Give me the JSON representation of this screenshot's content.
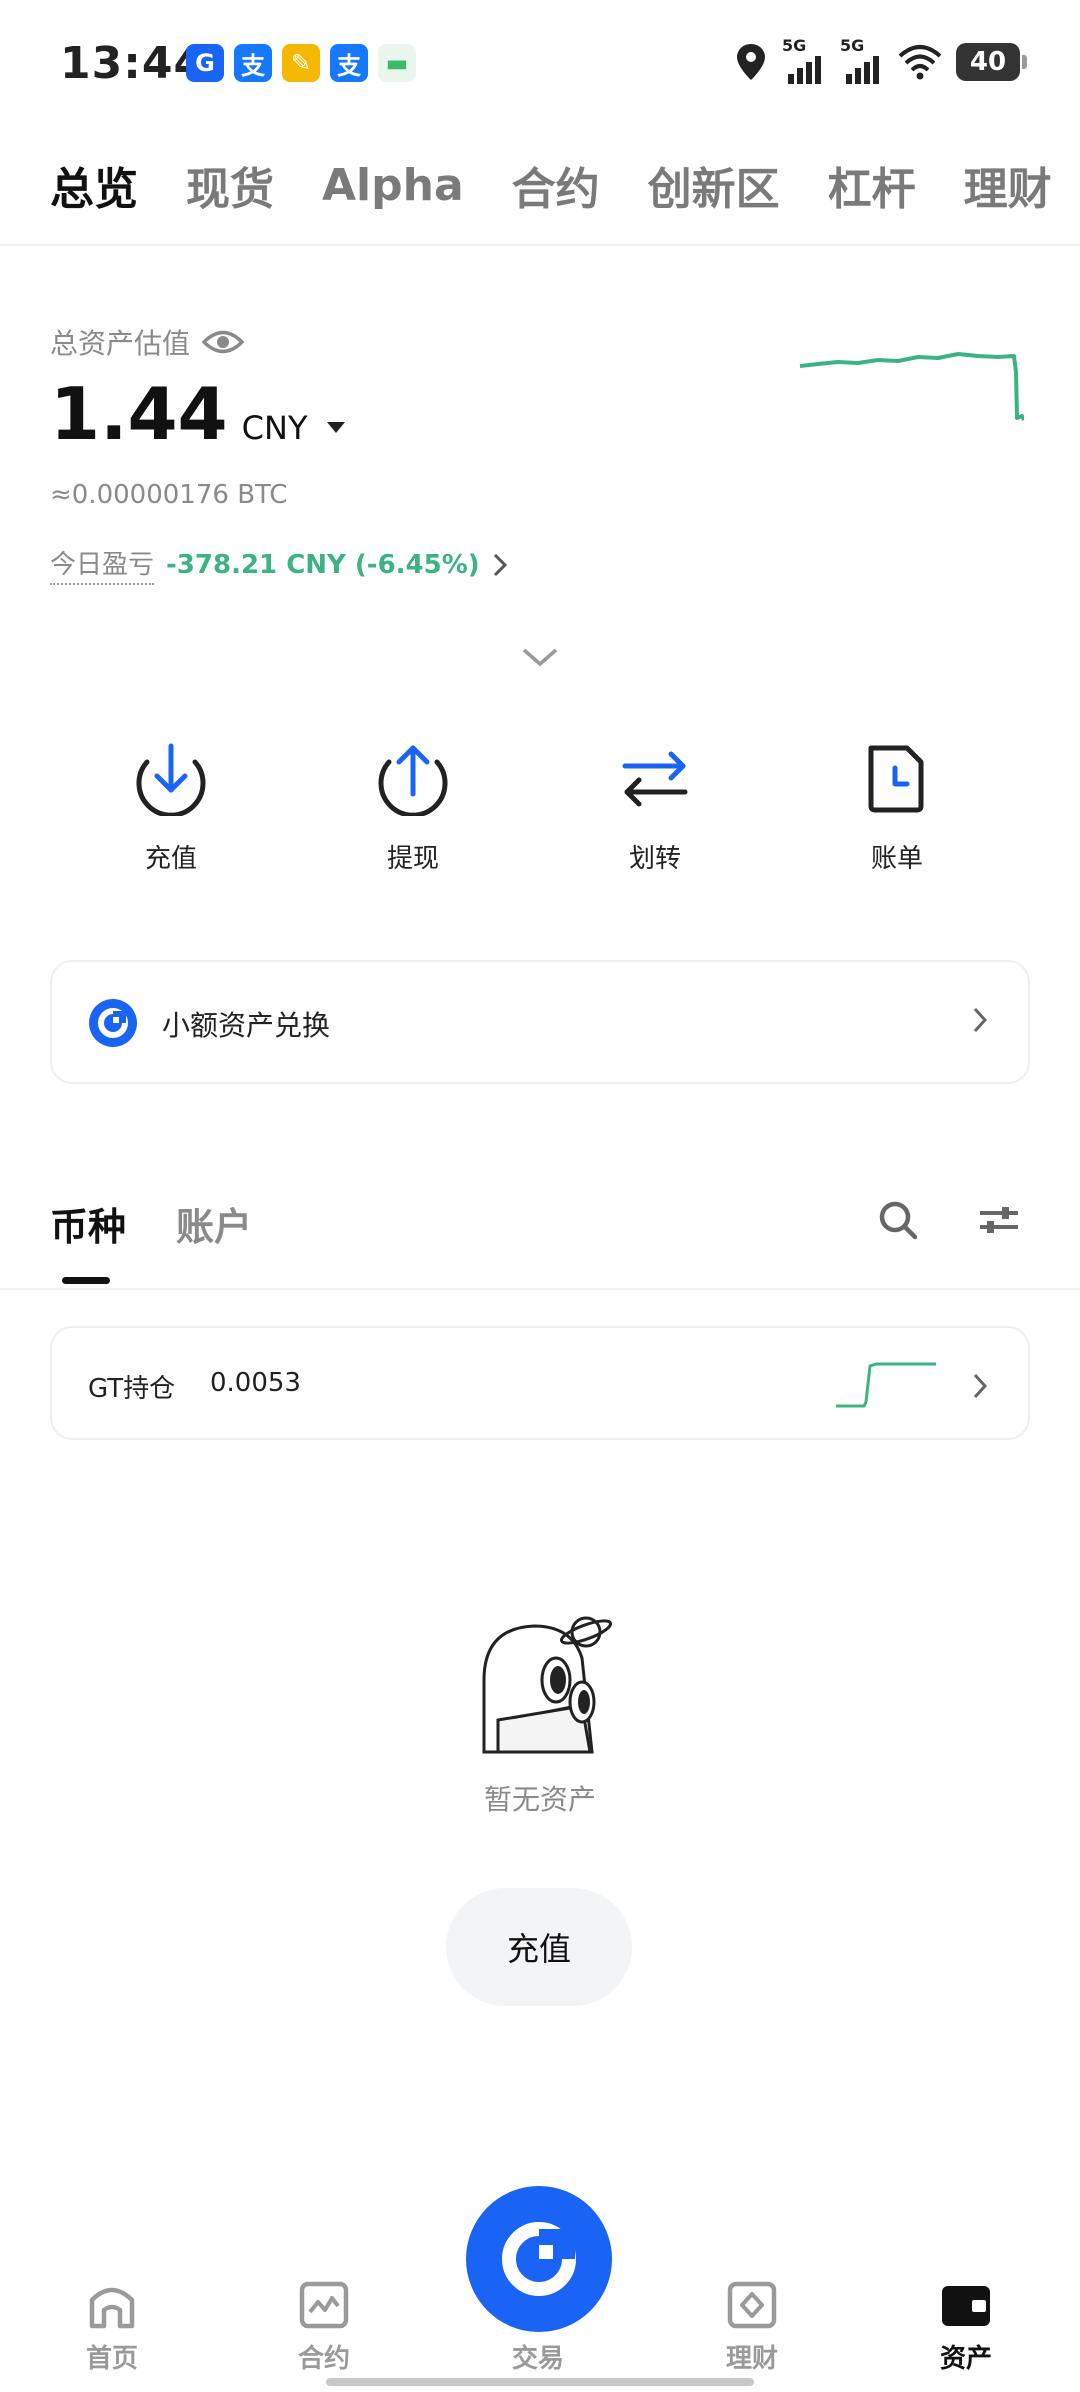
{
  "status_bar": {
    "time": "13:44",
    "notification_icons": [
      {
        "name": "gate-app-icon",
        "color": "#1a64f5",
        "glyph": "G"
      },
      {
        "name": "alipay-icon",
        "color": "#1677ff",
        "glyph": "支"
      },
      {
        "name": "app-notification-icon",
        "color": "#f5b800",
        "glyph": "✎"
      },
      {
        "name": "alipay-icon",
        "color": "#1677ff",
        "glyph": "支"
      },
      {
        "name": "wallet-icon",
        "color": "#3dbb6b",
        "glyph": "▬"
      }
    ],
    "signal_1": "5G",
    "signal_2": "5G",
    "battery": "40"
  },
  "top_tabs": [
    {
      "label": "总览",
      "active": true
    },
    {
      "label": "现货",
      "active": false
    },
    {
      "label": "Alpha",
      "active": false
    },
    {
      "label": "合约",
      "active": false
    },
    {
      "label": "创新区",
      "active": false
    },
    {
      "label": "杠杆",
      "active": false
    },
    {
      "label": "理财",
      "active": false
    }
  ],
  "overview": {
    "label": "总资产估值",
    "value": "1.44",
    "currency": "CNY",
    "btc_equivalent": "≈0.00000176 BTC",
    "pnl_label": "今日盈亏",
    "pnl_value": "-378.21 CNY (-6.45%)",
    "trend_color": "#3cb382"
  },
  "actions": [
    {
      "label": "充值",
      "icon": "deposit-icon"
    },
    {
      "label": "提现",
      "icon": "withdraw-icon"
    },
    {
      "label": "划转",
      "icon": "transfer-icon"
    },
    {
      "label": "账单",
      "icon": "bill-icon"
    }
  ],
  "small_asset_card": {
    "label": "小额资产兑换"
  },
  "sub_tabs": [
    {
      "label": "币种",
      "active": true
    },
    {
      "label": "账户",
      "active": false
    }
  ],
  "gt_card": {
    "label": "GT持仓",
    "amount": "0.0053"
  },
  "empty_state": {
    "text": "暂无资产",
    "button_label": "充值"
  },
  "bottom_nav": [
    {
      "label": "首页",
      "icon": "home-icon",
      "active": false
    },
    {
      "label": "合约",
      "icon": "futures-icon",
      "active": false
    },
    {
      "label": "交易",
      "icon": "trade-icon",
      "active": false
    },
    {
      "label": "理财",
      "icon": "earn-icon",
      "active": false
    },
    {
      "label": "资产",
      "icon": "wallet-icon",
      "active": true
    }
  ],
  "colors": {
    "accent": "#1a64f5",
    "positive_green": "#3cb382",
    "muted_text": "#8a8a8a"
  }
}
